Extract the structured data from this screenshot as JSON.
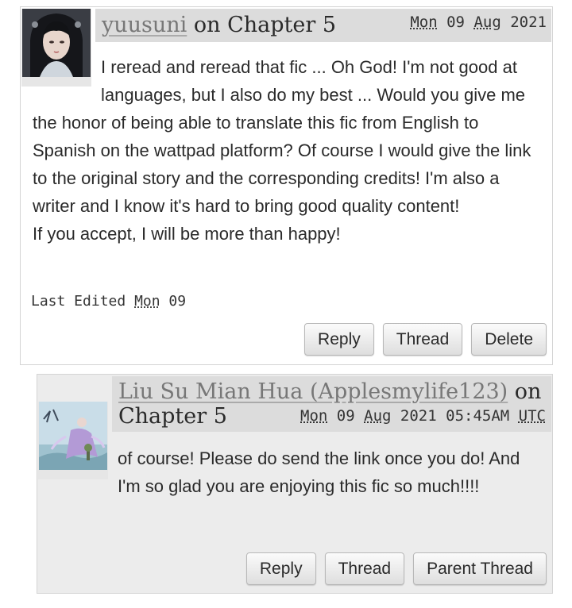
{
  "comments": [
    {
      "author": "yuusuni",
      "on_text": " on ",
      "chapter": "Chapter 5",
      "date": {
        "day": "Mon",
        "date": "09",
        "month": "Aug",
        "year": "2021"
      },
      "paragraphs": [
        "I reread and reread that fic ... Oh God! I'm not good at languages, but I also do my best ... Would you give me the honor of being able to translate this fic from English to Spanish on the wattpad platform? Of course I would give the link to the original story and the corresponding credits! I'm also a writer and I know it's hard to bring good quality content!",
        "If you accept, I will be more than happy!"
      ],
      "edited_label": "Last Edited",
      "edited_day": "Mon",
      "edited_date": "09",
      "actions": [
        "Reply",
        "Thread",
        "Delete"
      ]
    },
    {
      "author": "Liu Su Mian Hua (Applesmylife123)",
      "on_text": " on",
      "chapter": "Chapter 5",
      "date": {
        "day": "Mon",
        "date": "09",
        "month": "Aug",
        "year": "2021",
        "time": "05:45AM",
        "tz": "UTC"
      },
      "paragraphs": [
        "of course! Please do send the link once you do! And I'm so glad you are enjoying this fic so much!!!!"
      ],
      "actions": [
        "Reply",
        "Thread",
        "Parent Thread"
      ]
    }
  ],
  "colors": {
    "heading_bg": "#dcdcdc",
    "reply_bg": "#ececec",
    "author_link": "#777777"
  },
  "icons": {
    "avatar1": "portrait-avatar-icon",
    "avatar2": "painted-figure-avatar-icon"
  }
}
